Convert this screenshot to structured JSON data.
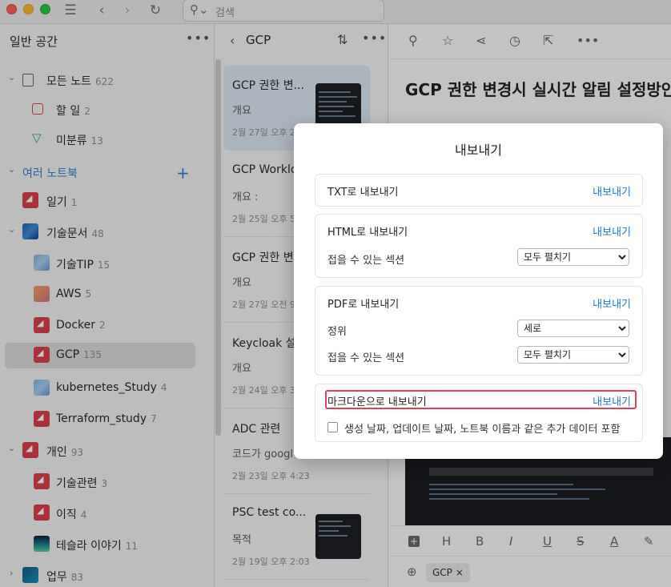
{
  "titlebar": {
    "search_placeholder": "검색",
    "icons": [
      "sidebar-toggle-icon",
      "back-icon",
      "forward-icon",
      "refresh-icon",
      "search-icon"
    ]
  },
  "sidebar": {
    "title": "일반 공간",
    "items": [
      {
        "label": "모든 노트",
        "count": "622"
      },
      {
        "label": "할 일",
        "count": "2"
      },
      {
        "label": "미분류",
        "count": "13"
      },
      {
        "label": "여러 노트북",
        "count": ""
      },
      {
        "label": "일기",
        "count": "1"
      },
      {
        "label": "기술문서",
        "count": "48"
      },
      {
        "label": "기술TIP",
        "count": "15"
      },
      {
        "label": "AWS",
        "count": "5"
      },
      {
        "label": "Docker",
        "count": "2"
      },
      {
        "label": "GCP",
        "count": "135"
      },
      {
        "label": "kubernetes_Study",
        "count": "4"
      },
      {
        "label": "Terraform_study",
        "count": "7"
      },
      {
        "label": "개인",
        "count": "93"
      },
      {
        "label": "기술관련",
        "count": "3"
      },
      {
        "label": "이직",
        "count": "4"
      },
      {
        "label": "테슬라 이야기",
        "count": "11"
      },
      {
        "label": "업무",
        "count": "83"
      }
    ]
  },
  "notelist": {
    "title": "GCP",
    "notes": [
      {
        "title": "GCP 권한 변...",
        "preview": "개요",
        "date": "2월 27일 오후 2:"
      },
      {
        "title": "GCP Worklo",
        "preview": "개요 :",
        "date": "2월 25일 오후 5:0"
      },
      {
        "title": "GCP 권한 변.",
        "preview": "개요",
        "date": "2월 27일 오전 9:3"
      },
      {
        "title": "Keycloak 설.",
        "preview": "개요",
        "date": "2월 24일 오후 3:2"
      },
      {
        "title": "ADC 관련",
        "preview": "코드가 googl",
        "date": "2월 23일 오후 4:23"
      },
      {
        "title": "PSC test co...",
        "preview": "목적",
        "date": "2월 19일 오후 2:03"
      }
    ]
  },
  "editor": {
    "title": "GCP 권한 변경시 실시간 알림 설정방안",
    "tag": "GCP",
    "format_buttons": [
      "H",
      "B",
      "I",
      "U",
      "S",
      "A"
    ]
  },
  "dialog": {
    "title": "내보내기",
    "export_label": "내보내기",
    "txt": {
      "label": "TXT로 내보내기"
    },
    "html": {
      "label": "HTML로 내보내기",
      "collapsible_label": "접을 수 있는 섹션",
      "collapsible_value": "모두 펼치기"
    },
    "pdf": {
      "label": "PDF로 내보내기",
      "orientation_label": "정위",
      "orientation_value": "세로",
      "collapsible_label": "접을 수 있는 섹션",
      "collapsible_value": "모두 펼치기"
    },
    "markdown": {
      "label": "마크다운으로 내보내기",
      "checkbox_label": "생성 날짜, 업데이트 날짜, 노트북 이름과 같은 추가 데이터 포함"
    }
  }
}
